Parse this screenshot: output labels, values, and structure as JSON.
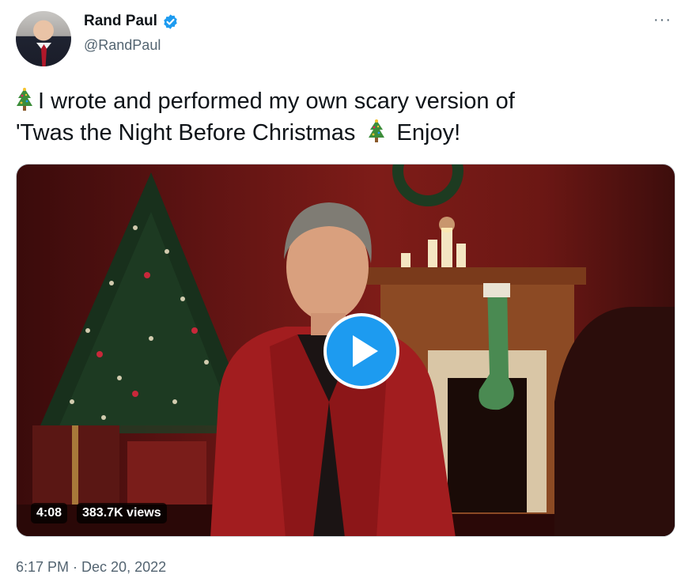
{
  "author": {
    "display_name": "Rand Paul",
    "handle": "@RandPaul",
    "verified": true,
    "verified_color": "#1d9bf0",
    "avatar": "avatar-photo"
  },
  "menu": {
    "more_label": "···"
  },
  "tweet": {
    "line1": "I wrote and performed my own scary version of",
    "line2_a": "'Twas the Night Before Christmas",
    "line2_b": "Enjoy!",
    "emoji": "christmas-tree-emoji"
  },
  "video": {
    "duration": "4:08",
    "views": "383.7K views",
    "play_color": "#1d9bf0"
  },
  "meta": {
    "timestamp": "6:17 PM · Dec 20, 2022"
  }
}
